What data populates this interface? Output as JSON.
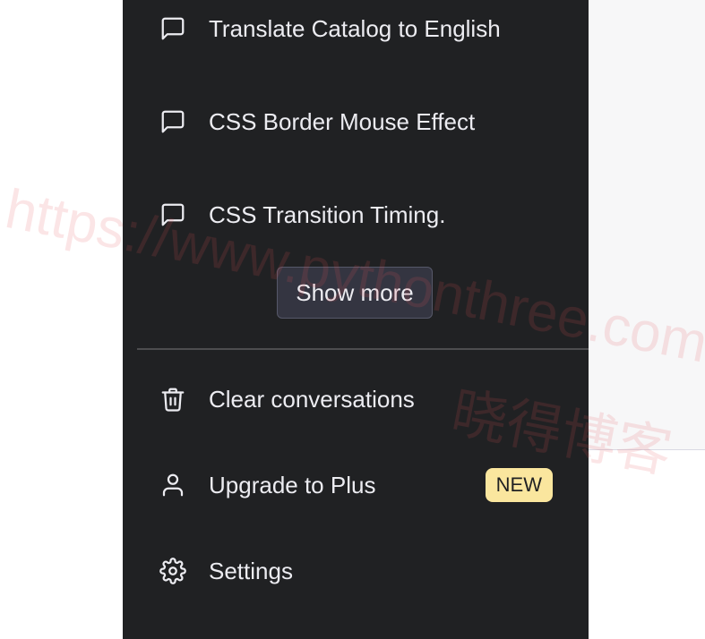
{
  "history": [
    {
      "label": "Translate Catalog to English",
      "icon": "chat-bubble-icon"
    },
    {
      "label": "CSS Border Mouse Effect",
      "icon": "chat-bubble-icon"
    },
    {
      "label": "CSS Transition Timing.",
      "icon": "chat-bubble-icon"
    }
  ],
  "show_more_label": "Show more",
  "menu": {
    "clear": "Clear conversations",
    "upgrade": "Upgrade to Plus",
    "upgrade_badge": "NEW",
    "settings": "Settings"
  },
  "watermark": {
    "url": "https://www.pythonthree.com",
    "cn": "晓得博客"
  },
  "colors": {
    "sidebar_bg": "#202123",
    "text": "#ececf1",
    "badge_bg": "#fae69e",
    "button_bg": "#343541"
  }
}
